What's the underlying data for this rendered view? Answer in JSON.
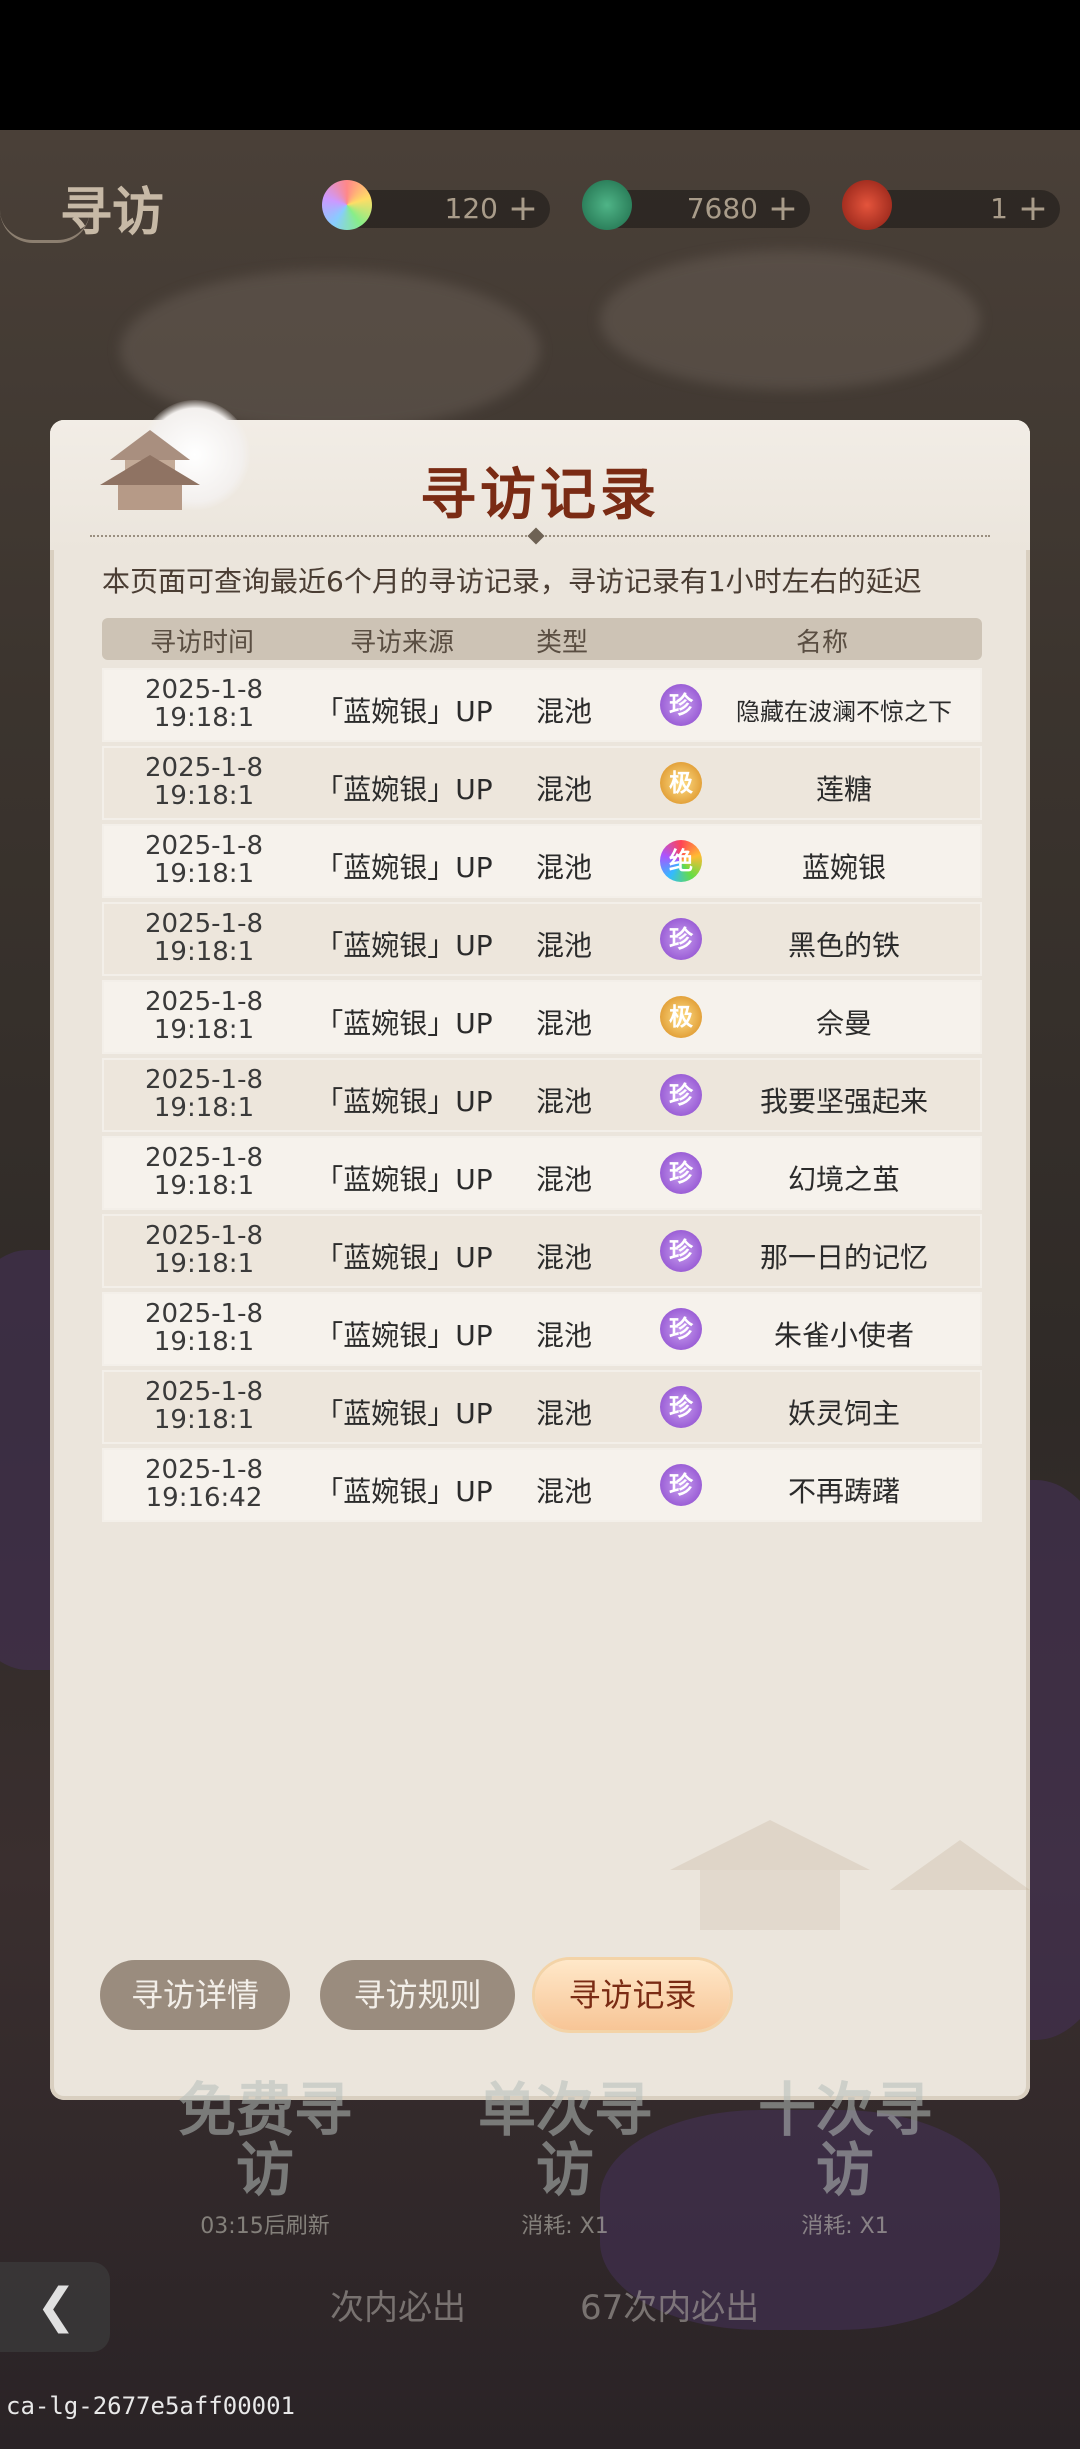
{
  "topbar": {
    "title": "寻访",
    "resources": [
      {
        "icon": "rainbow-gem-icon",
        "value": "120",
        "plus": "+"
      },
      {
        "icon": "jade-stone-icon",
        "value": "7680",
        "plus": "+"
      },
      {
        "icon": "red-feather-icon",
        "value": "1",
        "plus": "+"
      }
    ]
  },
  "dialog": {
    "title": "寻访记录",
    "description": "本页面可查询最近6个月的寻访记录，寻访记录有1小时左右的延迟",
    "columns": [
      "寻访时间",
      "寻访来源",
      "类型",
      "名称"
    ],
    "rows": [
      {
        "date": "2025-1-8",
        "time": "19:18:1",
        "source": "「蓝婉银」UP",
        "type": "混池",
        "rarity": "珍",
        "rarity_class": "zhen",
        "name": "隐藏在波澜不惊之下"
      },
      {
        "date": "2025-1-8",
        "time": "19:18:1",
        "source": "「蓝婉银」UP",
        "type": "混池",
        "rarity": "极",
        "rarity_class": "ji",
        "name": "莲糖"
      },
      {
        "date": "2025-1-8",
        "time": "19:18:1",
        "source": "「蓝婉银」UP",
        "type": "混池",
        "rarity": "绝",
        "rarity_class": "jue",
        "name": "蓝婉银"
      },
      {
        "date": "2025-1-8",
        "time": "19:18:1",
        "source": "「蓝婉银」UP",
        "type": "混池",
        "rarity": "珍",
        "rarity_class": "zhen",
        "name": "黑色的铁"
      },
      {
        "date": "2025-1-8",
        "time": "19:18:1",
        "source": "「蓝婉银」UP",
        "type": "混池",
        "rarity": "极",
        "rarity_class": "ji",
        "name": "佘曼"
      },
      {
        "date": "2025-1-8",
        "time": "19:18:1",
        "source": "「蓝婉银」UP",
        "type": "混池",
        "rarity": "珍",
        "rarity_class": "zhen",
        "name": "我要坚强起来"
      },
      {
        "date": "2025-1-8",
        "time": "19:18:1",
        "source": "「蓝婉银」UP",
        "type": "混池",
        "rarity": "珍",
        "rarity_class": "zhen",
        "name": "幻境之茧"
      },
      {
        "date": "2025-1-8",
        "time": "19:18:1",
        "source": "「蓝婉银」UP",
        "type": "混池",
        "rarity": "珍",
        "rarity_class": "zhen",
        "name": "那一日的记忆"
      },
      {
        "date": "2025-1-8",
        "time": "19:18:1",
        "source": "「蓝婉银」UP",
        "type": "混池",
        "rarity": "珍",
        "rarity_class": "zhen",
        "name": "朱雀小使者"
      },
      {
        "date": "2025-1-8",
        "time": "19:18:1",
        "source": "「蓝婉银」UP",
        "type": "混池",
        "rarity": "珍",
        "rarity_class": "zhen",
        "name": "妖灵饲主"
      },
      {
        "date": "2025-1-8",
        "time": "19:16:42",
        "source": "「蓝婉银」UP",
        "type": "混池",
        "rarity": "珍",
        "rarity_class": "zhen",
        "name": "不再踌躇"
      }
    ]
  },
  "tabs": [
    {
      "label": "寻访详情",
      "active": false
    },
    {
      "label": "寻访规则",
      "active": false
    },
    {
      "label": "寻访记录",
      "active": true
    }
  ],
  "bottom": {
    "buttons": [
      {
        "label": "免费寻访",
        "sub": "03:15后刷新"
      },
      {
        "label": "单次寻访",
        "sub": "消耗: X1"
      },
      {
        "label": "十次寻访",
        "sub": "消耗: X1"
      }
    ],
    "strip_left": "次内必出",
    "strip_right": "67次内必出"
  },
  "footer_id": "ca-lg-2677e5aff00001",
  "colors": {
    "title": "#7a2b14",
    "panel": "#ebe5dc",
    "active_tab": "#f7c596"
  }
}
